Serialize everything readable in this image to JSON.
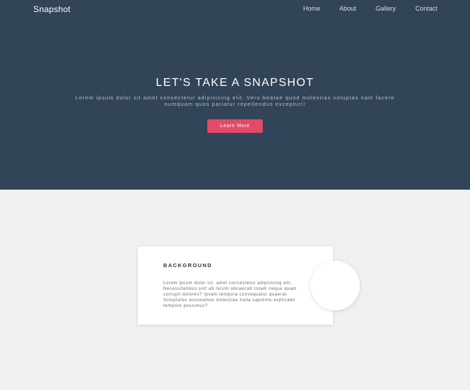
{
  "nav": {
    "brand": "Snapshot",
    "items": [
      {
        "label": "Home"
      },
      {
        "label": "About"
      },
      {
        "label": "Gallery"
      },
      {
        "label": "Contact"
      }
    ]
  },
  "hero": {
    "title": "LET'S TAKE A SNAPSHOT",
    "text": "Lorem ipsum dolor sit amet consectetur adipisicing elit. Vero beatae quod molestias voluptas nam facere numquam quos pariatur repellendus excepturi!",
    "button_label": "Learn More"
  },
  "card": {
    "title": "BACKGROUND",
    "text": "Lorem ipsum dolor sit, amet consectetur adipisicing elit. Necessitatibus sint ab rerum obcaecati totam neque quam corrupti dolores? Ipsam tempora consequatur quaerat. Voluptates accusamus molestiae nulla sapiente explicabo tempore possimus?"
  },
  "colors": {
    "hero_bg": "#324458",
    "accent": "#e24a68",
    "page_bg": "#f0f0f0"
  }
}
